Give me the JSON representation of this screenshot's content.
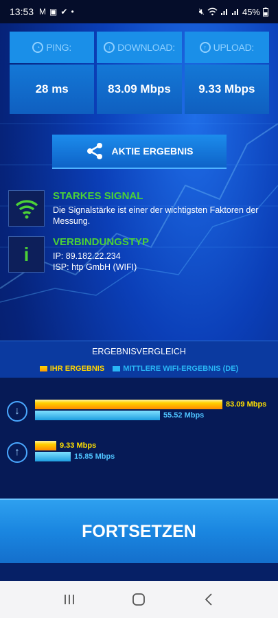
{
  "status_bar": {
    "time": "13:53",
    "battery": "45%",
    "icons": [
      "gmail-icon",
      "notification-icon",
      "check-icon",
      "dot-icon",
      "mute-icon",
      "wifi-icon",
      "signal-icon",
      "signal-icon",
      "battery-icon"
    ]
  },
  "tiles": [
    {
      "label": "PING:",
      "value": "28 ms",
      "icon": "ping-icon"
    },
    {
      "label": "DOWNLOAD:",
      "value": "83.09 Mbps",
      "icon": "download-icon"
    },
    {
      "label": "UPLOAD:",
      "value": "9.33 Mbps",
      "icon": "upload-icon"
    }
  ],
  "share_button": {
    "label": "AKTIE ERGEBNIS",
    "icon": "share-icon"
  },
  "signal": {
    "title": "STARKES SIGNAL",
    "description": "Die Signalstärke ist einer der wichtigsten Faktoren der Messung."
  },
  "connection": {
    "title": "VERBINDUNGSTYP",
    "ip": "IP: 89.182.22.234",
    "isp": "ISP: htp GmbH (WIFI)"
  },
  "comparison": {
    "title": "ERGEBNISVERGLEICH",
    "legend_yours": "IHR ERGEBNIS",
    "legend_avg": "MITTLERE WIFI-ERGEBNIS (DE)",
    "colors": {
      "yours": "#ffd000",
      "avg": "#29b6f6"
    },
    "download": {
      "yours": 83.09,
      "avg": 55.52,
      "yours_label": "83.09 Mbps",
      "avg_label": "55.52 Mbps"
    },
    "upload": {
      "yours": 9.33,
      "avg": 15.85,
      "yours_label": "9.33 Mbps",
      "avg_label": "15.85 Mbps"
    }
  },
  "continue_button": {
    "label": "FORTSETZEN"
  },
  "nav": [
    "recent-apps-icon",
    "home-icon",
    "back-icon"
  ]
}
